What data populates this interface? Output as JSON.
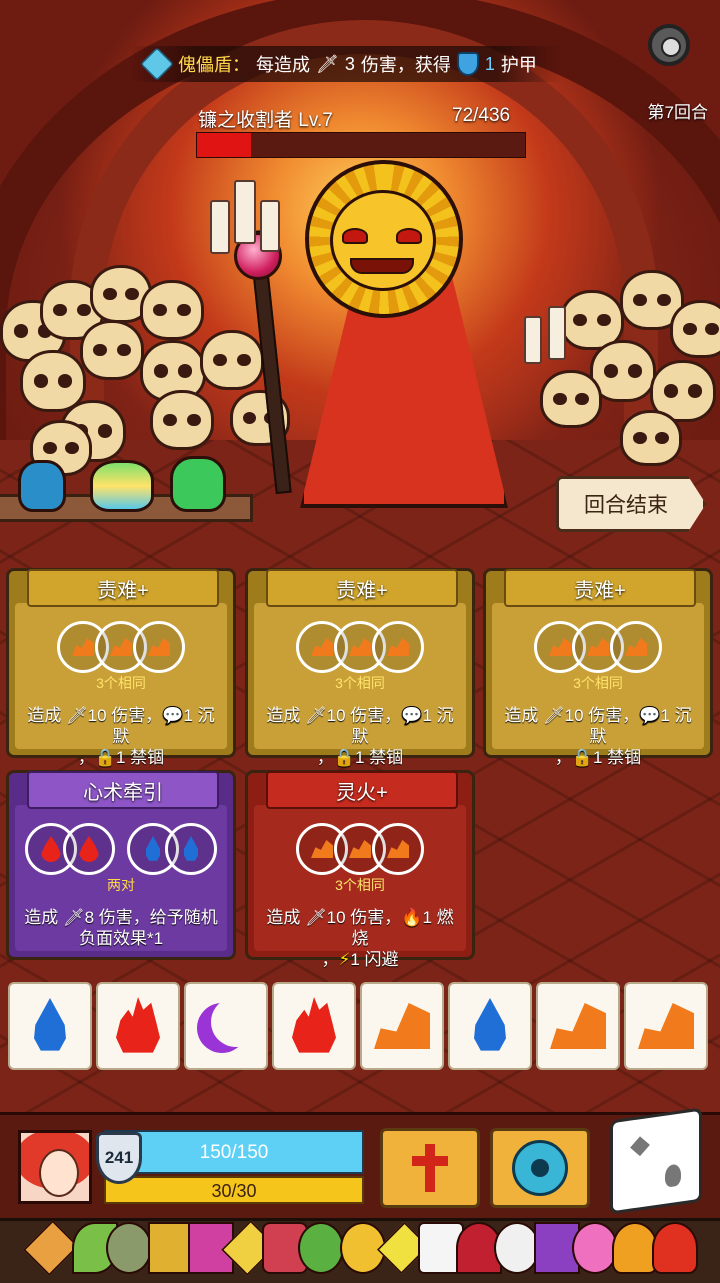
{
  "buff": {
    "name": "傀儡盾：",
    "text_before": "每造成",
    "damage_value": "3",
    "text_middle": "伤害，获得",
    "armor_value": "1",
    "text_after": "护甲"
  },
  "round_label": "第7回合",
  "boss": {
    "name": "镰之收割者",
    "level": "Lv.7",
    "hp_text": "72/436",
    "hp_fraction": 0.165
  },
  "end_turn_label": "回合结束",
  "cards": [
    {
      "title": "责难+",
      "theme": "gold",
      "requirement": "3个相同",
      "desc_line1": [
        "造成 ",
        "🗡",
        "10 伤害，",
        "💬",
        "1 沉默"
      ],
      "desc_line2": [
        "，",
        "🔒",
        "1 禁锢"
      ]
    },
    {
      "title": "责难+",
      "theme": "gold",
      "requirement": "3个相同",
      "desc_line1": [
        "造成 ",
        "🗡",
        "10 伤害，",
        "💬",
        "1 沉默"
      ],
      "desc_line2": [
        "，",
        "🔒",
        "1 禁锢"
      ]
    },
    {
      "title": "责难+",
      "theme": "gold",
      "requirement": "3个相同",
      "desc_line1": [
        "造成 ",
        "🗡",
        "10 伤害，",
        "💬",
        "1 沉默"
      ],
      "desc_line2": [
        "，",
        "🔒",
        "1 禁锢"
      ]
    },
    {
      "title": "心术牵引",
      "theme": "purple",
      "requirement": "两对",
      "desc_line1": [
        "造成 ",
        "🗡",
        "8 伤害，给予随机"
      ],
      "desc_line2": [
        "负面效果*1"
      ]
    },
    {
      "title": "灵火+",
      "theme": "red",
      "requirement": "3个相同",
      "desc_line1": [
        "造成 ",
        "🗡",
        "10 伤害，",
        "🔥",
        "1 燃烧"
      ],
      "desc_line2": [
        "，",
        "⚡",
        "1 闪避"
      ]
    }
  ],
  "element_tiles": [
    "water",
    "fire",
    "moon",
    "fire",
    "earth",
    "water",
    "earth",
    "earth"
  ],
  "player": {
    "armor": "241",
    "hp_text": "150/150",
    "energy_text": "30/30"
  },
  "skills": [
    "cross-icon",
    "eye-icon"
  ],
  "colors": {
    "card_gold": "#c9a038",
    "card_purple": "#6c3aa0",
    "card_red": "#a52a1d",
    "hp": "#5ed0f6",
    "energy": "#f5c51c",
    "boss_hp": "#e11414"
  }
}
